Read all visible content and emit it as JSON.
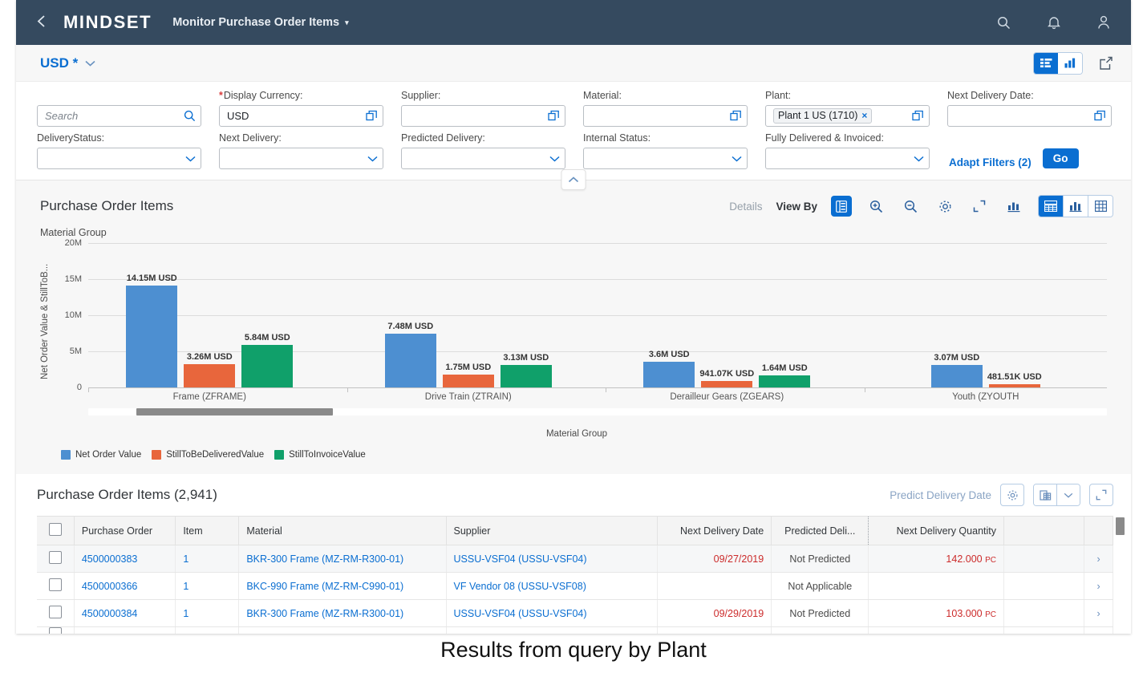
{
  "shell": {
    "back_label": "‹",
    "brand": "MIND SET",
    "brand_display": "MINDSET",
    "app_title": "Monitor Purchase Order Items",
    "caret": "▾",
    "icons": [
      "search-icon",
      "bell-icon",
      "user-icon"
    ]
  },
  "variant_bar": {
    "variant_name": "USD *",
    "chevron": "∨",
    "toggle": [
      "list-view-icon",
      "chart-view-icon"
    ],
    "share_icon": "share-icon"
  },
  "filters": {
    "search": {
      "label": "",
      "placeholder": "Search",
      "value": ""
    },
    "display_currency": {
      "label": "Display Currency:",
      "required": true,
      "value": "USD"
    },
    "supplier": {
      "label": "Supplier:",
      "value": ""
    },
    "material": {
      "label": "Material:",
      "value": ""
    },
    "plant": {
      "label": "Plant:",
      "token": "Plant 1 US (1710)",
      "token_remove": "×"
    },
    "next_delivery_date": {
      "label": "Next Delivery Date:",
      "value": ""
    },
    "delivery_status": {
      "label": "DeliveryStatus:",
      "value": ""
    },
    "next_delivery": {
      "label": "Next Delivery:",
      "value": ""
    },
    "predicted_delivery": {
      "label": "Predicted Delivery:",
      "value": ""
    },
    "internal_status": {
      "label": "Internal Status:",
      "value": ""
    },
    "fully_delivered_invoiced": {
      "label": "Fully Delivered & Invoiced:",
      "value": ""
    },
    "adapt_filters": "Adapt Filters (2)",
    "go": "Go",
    "collapse_icon": "chevron-up-icon"
  },
  "chart_card": {
    "title": "Purchase Order Items",
    "dimension_label": "Material Group",
    "details": "Details",
    "view_by": "View By",
    "tool_icons": [
      "dimension-icon",
      "zoom-in-icon",
      "zoom-out-icon",
      "settings-icon",
      "fullscreen-icon",
      "chart-type-icon"
    ],
    "view_group": [
      "combined-view-icon",
      "chart-only-icon",
      "table-only-icon"
    ]
  },
  "chart_data": {
    "type": "bar",
    "title": "Purchase Order Items",
    "xlabel": "Material Group",
    "ylabel": "Net Order Value & StillToB...",
    "ylim": [
      0,
      20000000
    ],
    "yticks": [
      "0",
      "5M",
      "10M",
      "15M",
      "20M"
    ],
    "ytick_values": [
      0,
      5000000,
      10000000,
      15000000,
      20000000
    ],
    "grid": true,
    "legend_position": "bottom-left",
    "categories": [
      "Frame (ZFRAME)",
      "Drive Train (ZTRAIN)",
      "Derailleur Gears (ZGEARS)",
      "Youth (ZYOUTH"
    ],
    "series": [
      {
        "name": "Net Order Value",
        "color": "#4d8fd1",
        "values": [
          14150000,
          7480000,
          3600000,
          3070000
        ],
        "labels": [
          "14.15M USD",
          "7.48M USD",
          "3.6M USD",
          "3.07M USD"
        ]
      },
      {
        "name": "StillToBeDeliveredValue",
        "color": "#e8663c",
        "values": [
          3260000,
          1750000,
          941070,
          481510
        ],
        "labels": [
          "3.26M USD",
          "1.75M USD",
          "941.07K USD",
          "481.51K USD"
        ]
      },
      {
        "name": "StillToInvoiceValue",
        "color": "#10a06a",
        "values": [
          5840000,
          3130000,
          1640000,
          null
        ],
        "labels": [
          "5.84M USD",
          "3.13M USD",
          "1.64M USD",
          ""
        ]
      }
    ]
  },
  "table": {
    "title": "Purchase Order Items (2,941)",
    "predict_link": "Predict Delivery Date",
    "tool_icons": [
      "settings-icon",
      "export-icon",
      "chevron-down-icon",
      "fullscreen-icon"
    ],
    "columns": [
      "",
      "Purchase Order",
      "Item",
      "Material",
      "Supplier",
      "Next Delivery Date",
      "Predicted Deli...",
      "Next Delivery Quantity",
      "",
      ""
    ],
    "rows": [
      {
        "purchase_order": "4500000383",
        "item": "1",
        "material": "BKR-300 Frame (MZ-RM-R300-01)",
        "supplier": "USSU-VSF04 (USSU-VSF04)",
        "next_delivery_date": "09/27/2019",
        "predicted_delivery": "Not Predicted",
        "next_delivery_qty": "142.000",
        "uom": "PC",
        "nav": "›"
      },
      {
        "purchase_order": "4500000366",
        "item": "1",
        "material": "BKC-990 Frame (MZ-RM-C990-01)",
        "supplier": "VF Vendor 08 (USSU-VSF08)",
        "next_delivery_date": "",
        "predicted_delivery": "Not Applicable",
        "next_delivery_qty": "",
        "uom": "",
        "nav": "›"
      },
      {
        "purchase_order": "4500000384",
        "item": "1",
        "material": "BKR-300 Frame (MZ-RM-R300-01)",
        "supplier": "USSU-VSF04 (USSU-VSF04)",
        "next_delivery_date": "09/29/2019",
        "predicted_delivery": "Not Predicted",
        "next_delivery_qty": "103.000",
        "uom": "PC",
        "nav": "›"
      }
    ]
  },
  "caption": "Results from query by Plant",
  "colors": {
    "shell_bg": "#354a5f",
    "accent": "#0a6ed1",
    "series_blue": "#4d8fd1",
    "series_orange": "#e8663c",
    "series_green": "#10a06a",
    "red_text": "#cc2b2b"
  }
}
